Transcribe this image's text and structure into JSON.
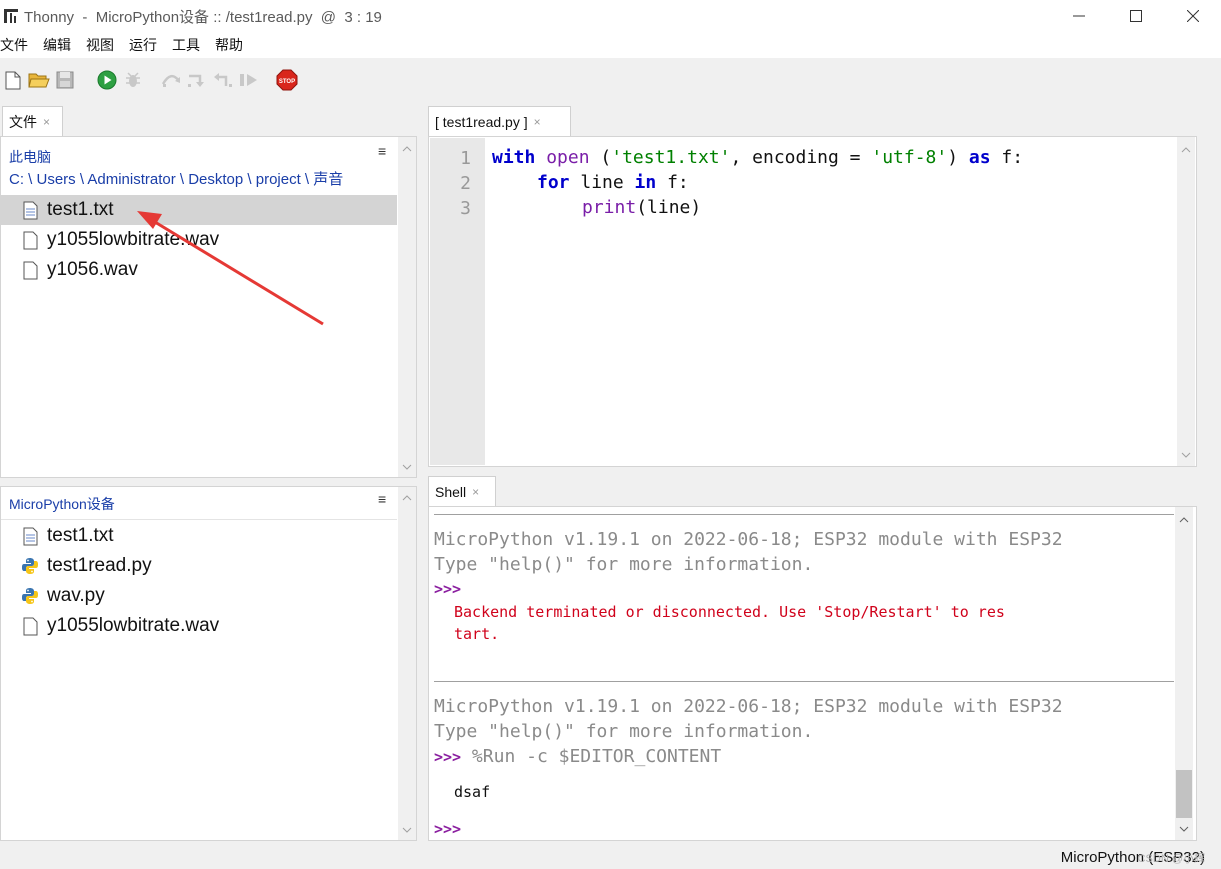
{
  "window": {
    "title": "Thonny  -  MicroPython设备 :: /test1read.py  @  3 : 19",
    "minimize_glyph": "—",
    "maximize_glyph": "☐",
    "close_glyph": "✕"
  },
  "menu": {
    "items": [
      "文件",
      "编辑",
      "视图",
      "运行",
      "工具",
      "帮助"
    ]
  },
  "toolbar": {
    "icons": [
      "new-file-icon",
      "open-file-icon",
      "save-icon",
      "run-icon",
      "debug-icon",
      "step-over-icon",
      "step-into-icon",
      "step-out-icon",
      "resume-icon",
      "stop-icon"
    ],
    "stop_label": "STOP"
  },
  "files_panel": {
    "tab_label": "文件",
    "tab_close": "×",
    "local": {
      "header": "此电脑",
      "path": "C: \\ Users \\ Administrator \\ Desktop \\ project \\ 声音",
      "files": [
        "test1.txt",
        "y1055lowbitrate.wav",
        "y1056.wav"
      ]
    },
    "device": {
      "header": "MicroPython设备",
      "files": [
        "test1.txt",
        "test1read.py",
        "wav.py",
        "y1055lowbitrate.wav"
      ]
    }
  },
  "editor": {
    "tab_label": "[ test1read.py ]",
    "tab_close": "×",
    "line_numbers": [
      "1",
      "2",
      "3"
    ],
    "code": {
      "l1": {
        "kw_with": "with",
        "fn_open": "open",
        "p1": " (",
        "s1": "'test1.txt'",
        "p2": ", encoding = ",
        "s2": "'utf-8'",
        "p3": ") ",
        "kw_as": "as",
        "p4": " f:"
      },
      "l2": {
        "kw_for": "for",
        "p1": " line ",
        "kw_in": "in",
        "p2": " f:"
      },
      "l3": {
        "fn_print": "print",
        "p1": "(line)"
      }
    }
  },
  "shell": {
    "tab_label": "Shell",
    "tab_close": "×",
    "banner1": "MicroPython v1.19.1 on 2022-06-18; ESP32 module with ESP32",
    "help1": "Type \"help()\" for more information.",
    "prompt": ">>>",
    "error_l1": "Backend terminated or disconnected. Use 'Stop/Restart' to res",
    "error_l2": "tart.",
    "banner2": "MicroPython v1.19.1 on 2022-06-18; ESP32 module with ESP32",
    "help2": "Type \"help()\" for more information.",
    "run_cmd": " %Run -c $EDITOR_CONTENT",
    "output": "dsaf"
  },
  "status": {
    "interpreter": "MicroPython (ESP32)",
    "watermark": "CSDN @小辉"
  },
  "annotation": {
    "arrow_color": "#e53935"
  }
}
